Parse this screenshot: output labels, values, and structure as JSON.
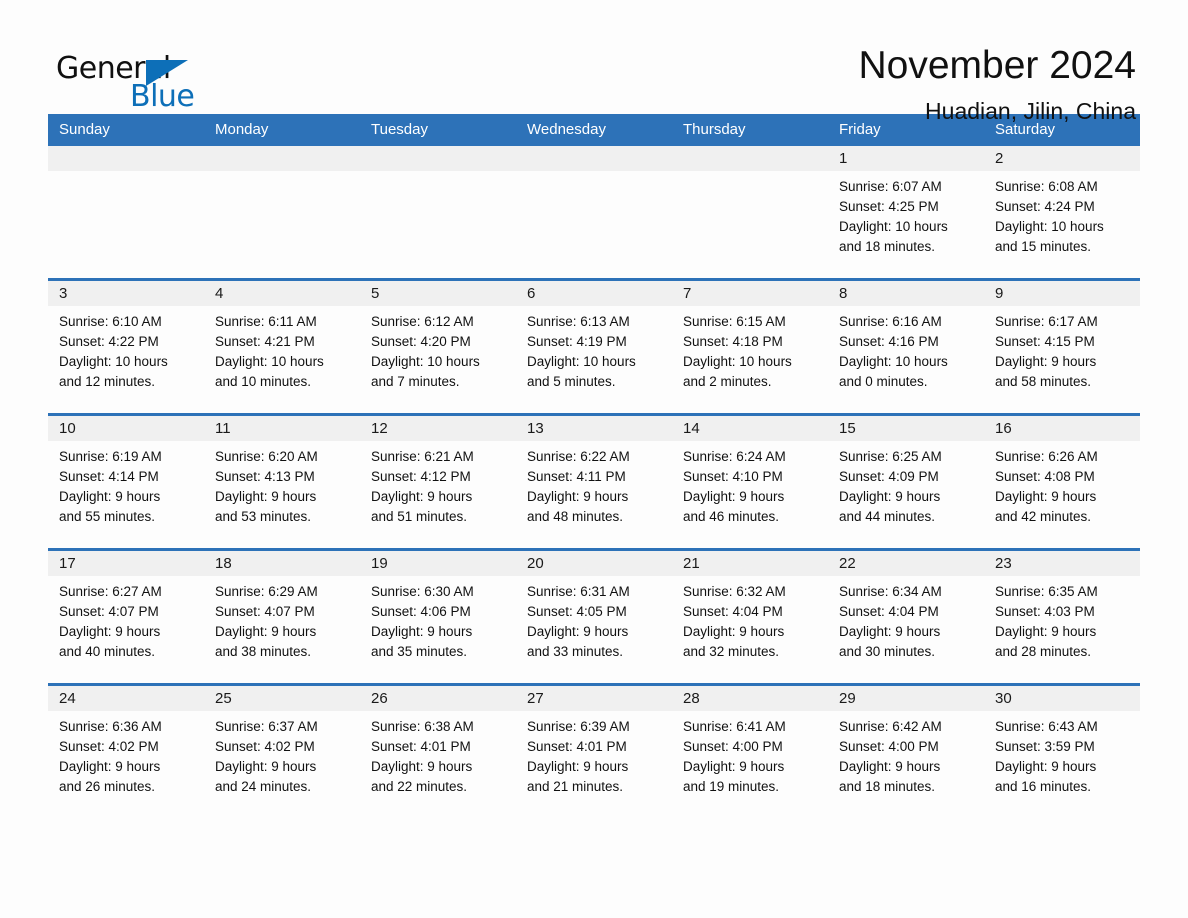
{
  "logo": {
    "word_one": "General",
    "word_two": "Blue",
    "triangle_color": "#0d6fb8"
  },
  "header": {
    "title": "November 2024",
    "location": "Huadian, Jilin, China"
  },
  "theme": {
    "header_blue": "#2d72b8",
    "daynum_bg": "#f0f0f0",
    "page_bg": "#fdfdfd",
    "text": "#111111"
  },
  "calendar": {
    "weekday_headers": [
      "Sunday",
      "Monday",
      "Tuesday",
      "Wednesday",
      "Thursday",
      "Friday",
      "Saturday"
    ],
    "weeks": [
      [
        {
          "day": "",
          "sunrise": "",
          "sunset": "",
          "daylight_1": "",
          "daylight_2": ""
        },
        {
          "day": "",
          "sunrise": "",
          "sunset": "",
          "daylight_1": "",
          "daylight_2": ""
        },
        {
          "day": "",
          "sunrise": "",
          "sunset": "",
          "daylight_1": "",
          "daylight_2": ""
        },
        {
          "day": "",
          "sunrise": "",
          "sunset": "",
          "daylight_1": "",
          "daylight_2": ""
        },
        {
          "day": "",
          "sunrise": "",
          "sunset": "",
          "daylight_1": "",
          "daylight_2": ""
        },
        {
          "day": "1",
          "sunrise": "Sunrise: 6:07 AM",
          "sunset": "Sunset: 4:25 PM",
          "daylight_1": "Daylight: 10 hours",
          "daylight_2": "and 18 minutes."
        },
        {
          "day": "2",
          "sunrise": "Sunrise: 6:08 AM",
          "sunset": "Sunset: 4:24 PM",
          "daylight_1": "Daylight: 10 hours",
          "daylight_2": "and 15 minutes."
        }
      ],
      [
        {
          "day": "3",
          "sunrise": "Sunrise: 6:10 AM",
          "sunset": "Sunset: 4:22 PM",
          "daylight_1": "Daylight: 10 hours",
          "daylight_2": "and 12 minutes."
        },
        {
          "day": "4",
          "sunrise": "Sunrise: 6:11 AM",
          "sunset": "Sunset: 4:21 PM",
          "daylight_1": "Daylight: 10 hours",
          "daylight_2": "and 10 minutes."
        },
        {
          "day": "5",
          "sunrise": "Sunrise: 6:12 AM",
          "sunset": "Sunset: 4:20 PM",
          "daylight_1": "Daylight: 10 hours",
          "daylight_2": "and 7 minutes."
        },
        {
          "day": "6",
          "sunrise": "Sunrise: 6:13 AM",
          "sunset": "Sunset: 4:19 PM",
          "daylight_1": "Daylight: 10 hours",
          "daylight_2": "and 5 minutes."
        },
        {
          "day": "7",
          "sunrise": "Sunrise: 6:15 AM",
          "sunset": "Sunset: 4:18 PM",
          "daylight_1": "Daylight: 10 hours",
          "daylight_2": "and 2 minutes."
        },
        {
          "day": "8",
          "sunrise": "Sunrise: 6:16 AM",
          "sunset": "Sunset: 4:16 PM",
          "daylight_1": "Daylight: 10 hours",
          "daylight_2": "and 0 minutes."
        },
        {
          "day": "9",
          "sunrise": "Sunrise: 6:17 AM",
          "sunset": "Sunset: 4:15 PM",
          "daylight_1": "Daylight: 9 hours",
          "daylight_2": "and 58 minutes."
        }
      ],
      [
        {
          "day": "10",
          "sunrise": "Sunrise: 6:19 AM",
          "sunset": "Sunset: 4:14 PM",
          "daylight_1": "Daylight: 9 hours",
          "daylight_2": "and 55 minutes."
        },
        {
          "day": "11",
          "sunrise": "Sunrise: 6:20 AM",
          "sunset": "Sunset: 4:13 PM",
          "daylight_1": "Daylight: 9 hours",
          "daylight_2": "and 53 minutes."
        },
        {
          "day": "12",
          "sunrise": "Sunrise: 6:21 AM",
          "sunset": "Sunset: 4:12 PM",
          "daylight_1": "Daylight: 9 hours",
          "daylight_2": "and 51 minutes."
        },
        {
          "day": "13",
          "sunrise": "Sunrise: 6:22 AM",
          "sunset": "Sunset: 4:11 PM",
          "daylight_1": "Daylight: 9 hours",
          "daylight_2": "and 48 minutes."
        },
        {
          "day": "14",
          "sunrise": "Sunrise: 6:24 AM",
          "sunset": "Sunset: 4:10 PM",
          "daylight_1": "Daylight: 9 hours",
          "daylight_2": "and 46 minutes."
        },
        {
          "day": "15",
          "sunrise": "Sunrise: 6:25 AM",
          "sunset": "Sunset: 4:09 PM",
          "daylight_1": "Daylight: 9 hours",
          "daylight_2": "and 44 minutes."
        },
        {
          "day": "16",
          "sunrise": "Sunrise: 6:26 AM",
          "sunset": "Sunset: 4:08 PM",
          "daylight_1": "Daylight: 9 hours",
          "daylight_2": "and 42 minutes."
        }
      ],
      [
        {
          "day": "17",
          "sunrise": "Sunrise: 6:27 AM",
          "sunset": "Sunset: 4:07 PM",
          "daylight_1": "Daylight: 9 hours",
          "daylight_2": "and 40 minutes."
        },
        {
          "day": "18",
          "sunrise": "Sunrise: 6:29 AM",
          "sunset": "Sunset: 4:07 PM",
          "daylight_1": "Daylight: 9 hours",
          "daylight_2": "and 38 minutes."
        },
        {
          "day": "19",
          "sunrise": "Sunrise: 6:30 AM",
          "sunset": "Sunset: 4:06 PM",
          "daylight_1": "Daylight: 9 hours",
          "daylight_2": "and 35 minutes."
        },
        {
          "day": "20",
          "sunrise": "Sunrise: 6:31 AM",
          "sunset": "Sunset: 4:05 PM",
          "daylight_1": "Daylight: 9 hours",
          "daylight_2": "and 33 minutes."
        },
        {
          "day": "21",
          "sunrise": "Sunrise: 6:32 AM",
          "sunset": "Sunset: 4:04 PM",
          "daylight_1": "Daylight: 9 hours",
          "daylight_2": "and 32 minutes."
        },
        {
          "day": "22",
          "sunrise": "Sunrise: 6:34 AM",
          "sunset": "Sunset: 4:04 PM",
          "daylight_1": "Daylight: 9 hours",
          "daylight_2": "and 30 minutes."
        },
        {
          "day": "23",
          "sunrise": "Sunrise: 6:35 AM",
          "sunset": "Sunset: 4:03 PM",
          "daylight_1": "Daylight: 9 hours",
          "daylight_2": "and 28 minutes."
        }
      ],
      [
        {
          "day": "24",
          "sunrise": "Sunrise: 6:36 AM",
          "sunset": "Sunset: 4:02 PM",
          "daylight_1": "Daylight: 9 hours",
          "daylight_2": "and 26 minutes."
        },
        {
          "day": "25",
          "sunrise": "Sunrise: 6:37 AM",
          "sunset": "Sunset: 4:02 PM",
          "daylight_1": "Daylight: 9 hours",
          "daylight_2": "and 24 minutes."
        },
        {
          "day": "26",
          "sunrise": "Sunrise: 6:38 AM",
          "sunset": "Sunset: 4:01 PM",
          "daylight_1": "Daylight: 9 hours",
          "daylight_2": "and 22 minutes."
        },
        {
          "day": "27",
          "sunrise": "Sunrise: 6:39 AM",
          "sunset": "Sunset: 4:01 PM",
          "daylight_1": "Daylight: 9 hours",
          "daylight_2": "and 21 minutes."
        },
        {
          "day": "28",
          "sunrise": "Sunrise: 6:41 AM",
          "sunset": "Sunset: 4:00 PM",
          "daylight_1": "Daylight: 9 hours",
          "daylight_2": "and 19 minutes."
        },
        {
          "day": "29",
          "sunrise": "Sunrise: 6:42 AM",
          "sunset": "Sunset: 4:00 PM",
          "daylight_1": "Daylight: 9 hours",
          "daylight_2": "and 18 minutes."
        },
        {
          "day": "30",
          "sunrise": "Sunrise: 6:43 AM",
          "sunset": "Sunset: 3:59 PM",
          "daylight_1": "Daylight: 9 hours",
          "daylight_2": "and 16 minutes."
        }
      ]
    ]
  }
}
